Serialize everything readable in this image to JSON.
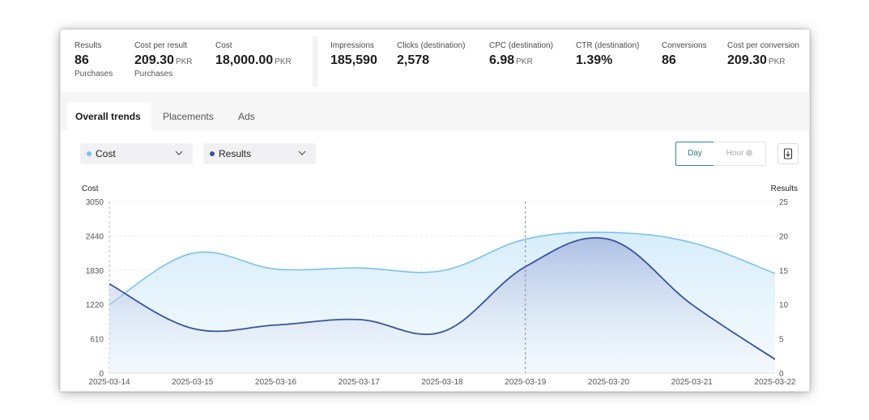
{
  "metrics": [
    {
      "label": "Results",
      "value": "86",
      "unit": "",
      "sub": "Purchases"
    },
    {
      "label": "Cost per result",
      "value": "209.30",
      "unit": "PKR",
      "sub": "Purchases"
    },
    {
      "label": "Cost",
      "value": "18,000.00",
      "unit": "PKR",
      "sub": ""
    },
    {
      "label": "Impressions",
      "value": "185,590",
      "unit": "",
      "sub": ""
    },
    {
      "label": "Clicks (destination)",
      "value": "2,578",
      "unit": "",
      "sub": ""
    },
    {
      "label": "CPC (destination)",
      "value": "6.98",
      "unit": "PKR",
      "sub": ""
    },
    {
      "label": "CTR (destination)",
      "value": "1.39%",
      "unit": "",
      "sub": ""
    },
    {
      "label": "Conversions",
      "value": "86",
      "unit": "",
      "sub": ""
    },
    {
      "label": "Cost per conversion",
      "value": "209.30",
      "unit": "PKR",
      "sub": ""
    }
  ],
  "tabs": [
    {
      "label": "Overall trends",
      "active": true
    },
    {
      "label": "Placements",
      "active": false
    },
    {
      "label": "Ads",
      "active": false
    }
  ],
  "controls": {
    "metric_left": {
      "label": "Cost",
      "dot_color": "#7cc1ec"
    },
    "metric_right": {
      "label": "Results",
      "dot_color": "#3a539b"
    },
    "granularity_day": "Day",
    "granularity_hour": "Hour",
    "chevron_glyph": "⌄",
    "export_icon": "export-icon"
  },
  "chart_data": {
    "type": "area",
    "ylabel_left": "Cost",
    "ylabel_right": "Results",
    "x": [
      "2025-03-14",
      "2025-03-15",
      "2025-03-16",
      "2025-03-17",
      "2025-03-18",
      "2025-03-19",
      "2025-03-20",
      "2025-03-21",
      "2025-03-22"
    ],
    "y_left_ticks": [
      "0",
      "610",
      "1220",
      "1830",
      "2440",
      "3050"
    ],
    "y_left_range": [
      0,
      3050
    ],
    "y_right_ticks": [
      "0",
      "5",
      "10",
      "15",
      "20",
      "25"
    ],
    "y_right_range": [
      0,
      25
    ],
    "series": [
      {
        "name": "Cost",
        "axis": "left",
        "color": "#7cc1ec",
        "values": [
          1220,
          2130,
          1850,
          1870,
          1820,
          2380,
          2500,
          2320,
          1770
        ]
      },
      {
        "name": "Results",
        "axis": "right",
        "color": "#3a539b",
        "values": [
          13,
          6.5,
          7,
          7.8,
          6,
          15.5,
          19.5,
          10,
          2
        ]
      }
    ],
    "hover_x": "2025-03-19",
    "grid": true
  }
}
